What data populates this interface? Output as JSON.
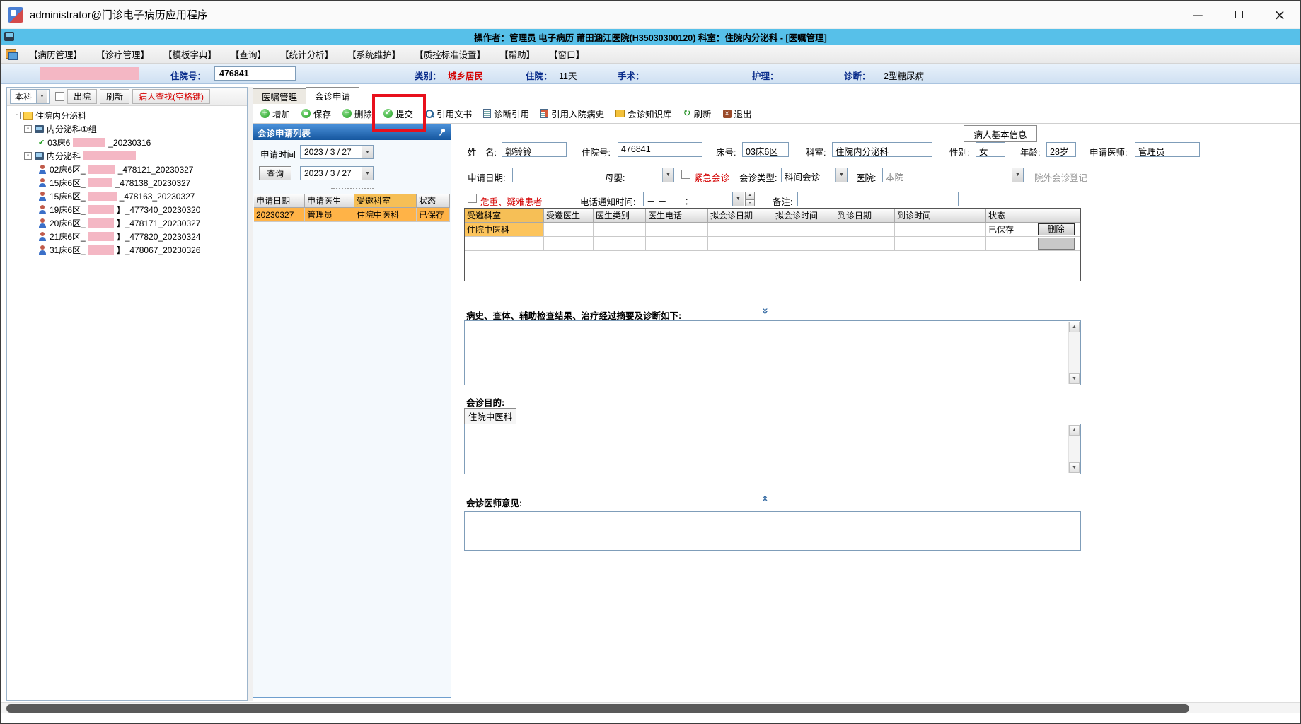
{
  "colors": {
    "info_bar_blue": "#57c0e9",
    "panel_header_blue": "#15569e",
    "selection_orange": "#ffb347",
    "column_header_orange": "#f6bf56",
    "redaction_pink": "#f4b7c4",
    "highlight_red": "#e8101c"
  },
  "icons": {
    "dropdown": "▼",
    "spin_up": "▲",
    "spin_down": "▼",
    "minimize": "—",
    "close": "×",
    "expand_open": "-",
    "plus": "+",
    "minus": "−",
    "check": "✔",
    "chev_double_down": "»",
    "chev_double_up": "«",
    "refresh_arrow": "↻",
    "cross": "×"
  },
  "window": {
    "title": "administrator@门诊电子病历应用程序"
  },
  "info_bar": {
    "text": "操作者：管理员 电子病历 莆田涵江医院(H35030300120) 科室：住院内分泌科 - [医嘱管理]"
  },
  "menu": {
    "items": [
      "【病历管理】",
      "【诊疗管理】",
      "【模板字典】",
      "【查询】",
      "【统计分析】",
      "【系统维护】",
      "【质控标准设置】",
      "【帮助】",
      "【窗口】"
    ]
  },
  "patient_bar": {
    "admission_label": "住院号：",
    "admission_value": "476841",
    "category_label": "类别：",
    "category_value": "城乡居民",
    "stay_label": "住院：",
    "stay_value": "11天",
    "surgery_label": "手术：",
    "nursing_label": "护理：",
    "diagnosis_label": "诊断：",
    "diagnosis_value": "2型糖尿病"
  },
  "sidebar": {
    "dept_combo": "本科",
    "discharge_label": "出院",
    "refresh_label": "刷新",
    "search_label": "病人查找(空格键)",
    "tree": {
      "root_label": "住院内分泌科",
      "group1_label": "内分泌科①组",
      "checked_item": {
        "prefix": "03床6",
        "suffix": "_20230316"
      },
      "group2_label": "内分泌科",
      "patients": [
        {
          "prefix": "02床6区_",
          "suffix": "_478121_20230327"
        },
        {
          "prefix": "15床6区_",
          "suffix": "_478138_20230327"
        },
        {
          "prefix": "15床6区_",
          "suffix": "_478163_20230327"
        },
        {
          "prefix": "19床6区_",
          "suffix": "】_477340_20230320"
        },
        {
          "prefix": "20床6区_",
          "suffix": "】_478171_20230327"
        },
        {
          "prefix": "21床6区_",
          "suffix": "】_477820_20230324"
        },
        {
          "prefix": "31床6区_",
          "suffix": "】_478067_20230326"
        }
      ]
    }
  },
  "tabs": {
    "orders": "医嘱管理",
    "consult": "会诊申请"
  },
  "toolbar": {
    "add": "增加",
    "save": "保存",
    "delete": "删除",
    "submit": "提交",
    "cite_doc": "引用文书",
    "cite_diag": "诊断引用",
    "cite_history": "引用入院病史",
    "knowledge": "会诊知识库",
    "refresh": "刷新",
    "exit": "退出"
  },
  "request_list": {
    "title": "会诊申请列表",
    "apply_time_label": "申请时间",
    "query_label": "查询",
    "date_from": "2023 / 3 / 27",
    "date_to": "2023 / 3 / 27",
    "columns": [
      "申请日期",
      "申请医生",
      "受邀科室",
      "状态"
    ],
    "row": [
      "20230327",
      "管理员",
      "住院中医科",
      "已保存"
    ]
  },
  "form": {
    "panel_tab": "病人基本信息",
    "name_label": "姓　名:",
    "name_value": "郭铃铃",
    "admission_label": "住院号:",
    "admission_value": "476841",
    "bed_label": "床号:",
    "bed_value": "03床6区",
    "dept_label": "科室:",
    "dept_value": "住院内分泌科",
    "gender_label": "性别:",
    "gender_value": "女",
    "age_label": "年龄:",
    "age_value": "28岁",
    "req_doctor_label": "申请医师:",
    "req_doctor_value": "管理员",
    "apply_date_label": "申请日期:",
    "maternal_label": "母婴:",
    "urgent_label": "紧急会诊",
    "type_label": "会诊类型:",
    "type_value": "科间会诊",
    "hospital_label": "医院:",
    "hospital_value": "本院",
    "external_reg_label": "院外会诊登记",
    "critical_label": "危重、疑难患者",
    "phone_label": "电话通知时间:",
    "phone_value": "－ －　　：",
    "remark_label": "备注:",
    "invite_columns": [
      "受邀科室",
      "受邀医生",
      "医生类别",
      "医生电话",
      "拟会诊日期",
      "拟会诊时间",
      "到诊日期",
      "到诊时间",
      "",
      "状态",
      ""
    ],
    "invite_row": {
      "dept": "住院中医科",
      "status": "已保存",
      "delete_label": "删除"
    },
    "history_label": "病史、查体、辅助检查结果、治疗经过摘要及诊断如下:",
    "purpose_label": "会诊目的:",
    "purpose_tab": "住院中医科",
    "opinion_label": "会诊医师意见:"
  }
}
